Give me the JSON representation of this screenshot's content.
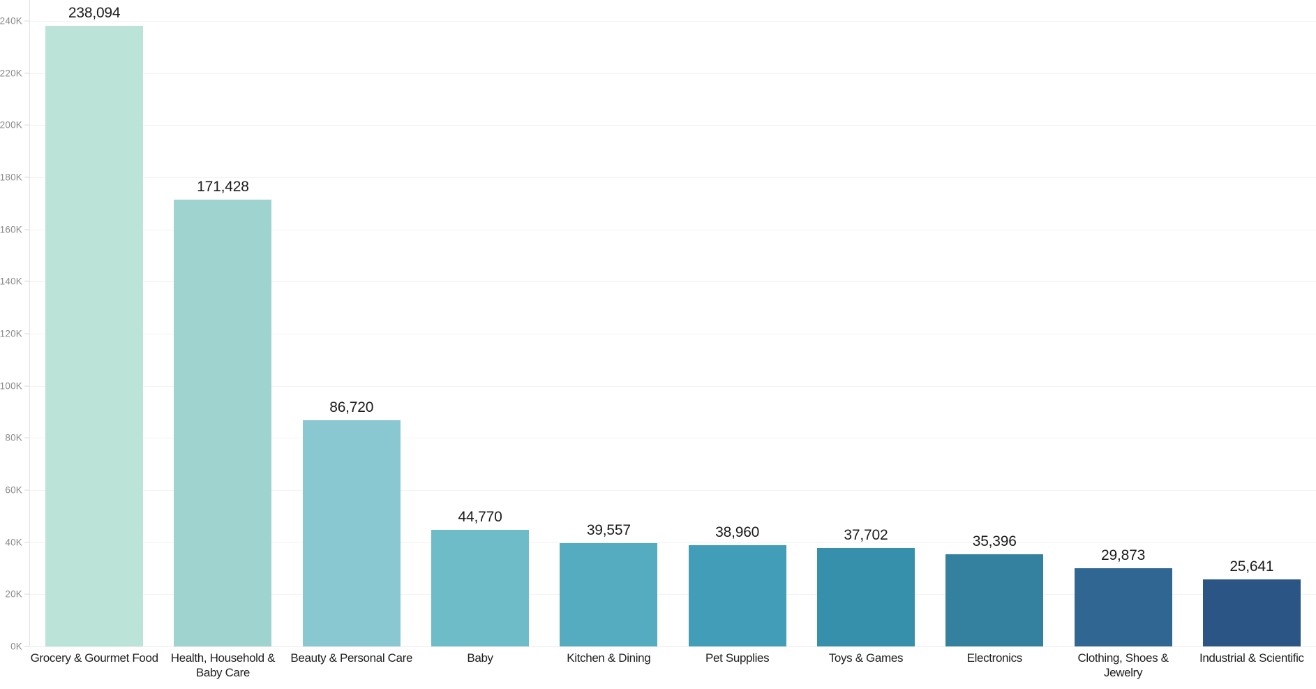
{
  "chart_data": {
    "type": "bar",
    "title": "",
    "subtitle": "",
    "xlabel": "",
    "ylabel": "",
    "orientation": "vertical",
    "grid": true,
    "legend": "none",
    "ylim": [
      0,
      248000
    ],
    "y_ticks": [
      {
        "value": 0,
        "label": "0K"
      },
      {
        "value": 20000,
        "label": "20K"
      },
      {
        "value": 40000,
        "label": "40K"
      },
      {
        "value": 60000,
        "label": "60K"
      },
      {
        "value": 80000,
        "label": "80K"
      },
      {
        "value": 100000,
        "label": "100K"
      },
      {
        "value": 120000,
        "label": "120K"
      },
      {
        "value": 140000,
        "label": "140K"
      },
      {
        "value": 160000,
        "label": "160K"
      },
      {
        "value": 180000,
        "label": "180K"
      },
      {
        "value": 200000,
        "label": "200K"
      },
      {
        "value": 220000,
        "label": "220K"
      },
      {
        "value": 240000,
        "label": "240K"
      }
    ],
    "categories": [
      "Grocery & Gourmet Food",
      "Health, Household & Baby Care",
      "Beauty & Personal Care",
      "Baby",
      "Kitchen & Dining",
      "Pet Supplies",
      "Toys & Games",
      "Electronics",
      "Clothing, Shoes & Jewelry",
      "Industrial & Scientific"
    ],
    "values": [
      238094,
      171428,
      86720,
      44770,
      39557,
      38960,
      37702,
      35396,
      29873,
      25641
    ],
    "value_labels": [
      "238,094",
      "171,428",
      "86,720",
      "44,770",
      "39,557",
      "38,960",
      "37,702",
      "35,396",
      "29,873",
      "25,641"
    ],
    "bar_colors": [
      "#bce3d8",
      "#9ed3cf",
      "#8ac8d1",
      "#6fbcc9",
      "#55abc0",
      "#429db9",
      "#3690ac",
      "#33809f",
      "#2f6792",
      "#2b5584"
    ]
  },
  "colors": {
    "background": "#ffffff",
    "gridline": "#f2f2f2",
    "axis_line": "#e3e3e3",
    "tick_text": "#8a8a8a",
    "value_text": "#1b1b1b",
    "category_text": "#1f1f1f"
  }
}
